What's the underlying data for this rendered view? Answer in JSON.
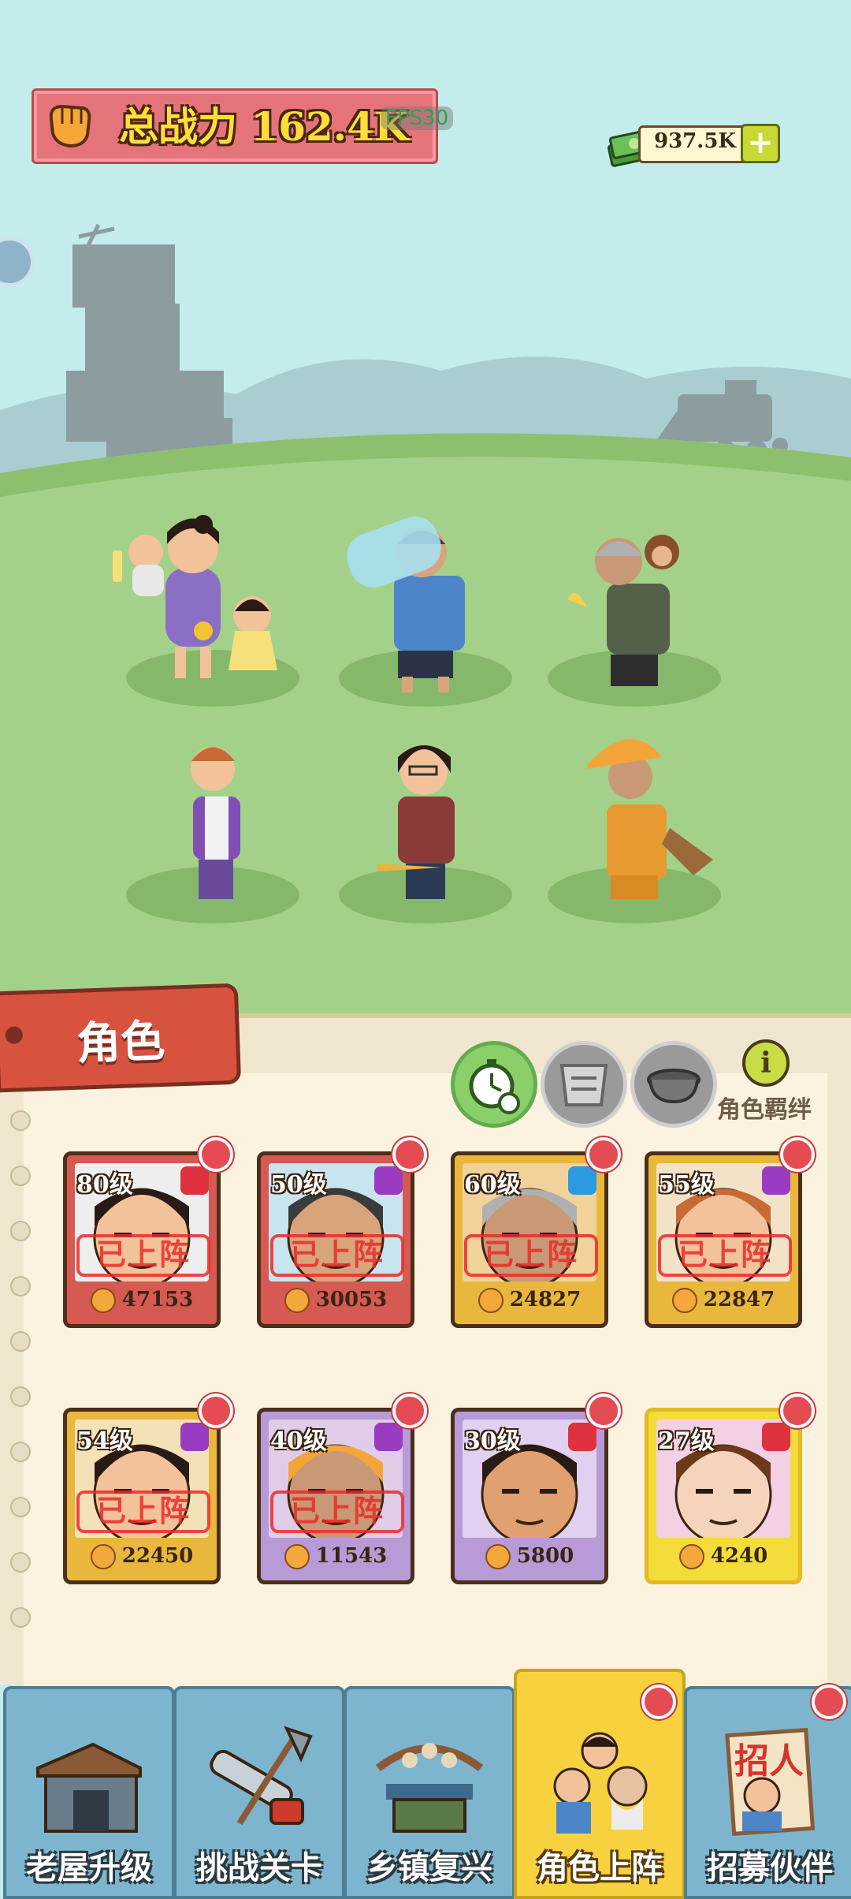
{
  "header": {
    "power_label": "总战力 162.4K",
    "fps": "FPS30",
    "money": "937.5K",
    "money_plus": "+"
  },
  "panel": {
    "tab_label": "角色",
    "bond_icon": "i",
    "bond_label": "角色羁绊"
  },
  "cards": [
    {
      "level": "80级",
      "power": "47153",
      "stamp": "已上阵",
      "rarity": "red",
      "type_icon": "cross-swords-icon",
      "type_color": "#e0323e"
    },
    {
      "level": "50级",
      "power": "30053",
      "stamp": "已上阵",
      "rarity": "red",
      "type_icon": "spiral-icon",
      "type_color": "#9a3cc2"
    },
    {
      "level": "60级",
      "power": "24827",
      "stamp": "已上阵",
      "rarity": "gold",
      "type_icon": "paw-icon",
      "type_color": "#2b9ae0"
    },
    {
      "level": "55级",
      "power": "22847",
      "stamp": "已上阵",
      "rarity": "gold",
      "type_icon": "spiral-icon",
      "type_color": "#9a3cc2"
    },
    {
      "level": "54级",
      "power": "22450",
      "stamp": "已上阵",
      "rarity": "gold",
      "type_icon": "spiral-icon",
      "type_color": "#9a3cc2"
    },
    {
      "level": "40级",
      "power": "11543",
      "stamp": "已上阵",
      "rarity": "purple",
      "type_icon": "spiral-icon",
      "type_color": "#9a3cc2"
    },
    {
      "level": "30级",
      "power": "5800",
      "stamp": "",
      "rarity": "purple",
      "type_icon": "cross-swords-icon",
      "type_color": "#e0323e"
    },
    {
      "level": "27级",
      "power": "4240",
      "stamp": "",
      "rarity": "yellow",
      "type_icon": "cross-swords-icon",
      "type_color": "#e0323e"
    }
  ],
  "nav": [
    {
      "label": "老屋升级",
      "icon": "house-icon"
    },
    {
      "label": "挑战关卡",
      "icon": "chainsaw-shovel-icon"
    },
    {
      "label": "乡镇复兴",
      "icon": "market-stall-icon"
    },
    {
      "label": "角色上阵",
      "icon": "characters-icon"
    },
    {
      "label": "招募伙伴",
      "icon": "recruit-poster-icon"
    }
  ],
  "colors": {
    "sky": "#c4ecec",
    "grass": "#a3d18a",
    "panel": "#f0e6cf",
    "accent_red": "#d8533f",
    "notification": "#e54b53"
  }
}
